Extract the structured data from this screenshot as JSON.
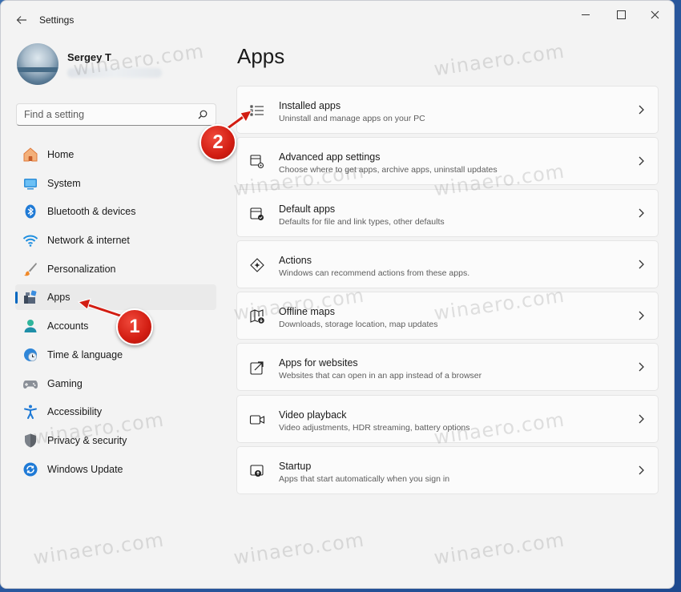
{
  "window": {
    "title": "Settings"
  },
  "profile": {
    "name": "Sergey T"
  },
  "search": {
    "placeholder": "Find a setting"
  },
  "nav": {
    "items": [
      {
        "label": "Home",
        "icon": "home-icon",
        "active": false
      },
      {
        "label": "System",
        "icon": "system-icon",
        "active": false
      },
      {
        "label": "Bluetooth & devices",
        "icon": "bluetooth-icon",
        "active": false
      },
      {
        "label": "Network & internet",
        "icon": "wifi-icon",
        "active": false
      },
      {
        "label": "Personalization",
        "icon": "brush-icon",
        "active": false
      },
      {
        "label": "Apps",
        "icon": "apps-icon",
        "active": true
      },
      {
        "label": "Accounts",
        "icon": "account-icon",
        "active": false
      },
      {
        "label": "Time & language",
        "icon": "clock-globe-icon",
        "active": false
      },
      {
        "label": "Gaming",
        "icon": "gamepad-icon",
        "active": false
      },
      {
        "label": "Accessibility",
        "icon": "accessibility-icon",
        "active": false
      },
      {
        "label": "Privacy & security",
        "icon": "shield-icon",
        "active": false
      },
      {
        "label": "Windows Update",
        "icon": "update-icon",
        "active": false
      }
    ]
  },
  "main": {
    "title": "Apps",
    "cards": [
      {
        "title": "Installed apps",
        "desc": "Uninstall and manage apps on your PC",
        "icon": "list-icon"
      },
      {
        "title": "Advanced app settings",
        "desc": "Choose where to get apps, archive apps, uninstall updates",
        "icon": "app-settings-icon"
      },
      {
        "title": "Default apps",
        "desc": "Defaults for file and link types, other defaults",
        "icon": "default-apps-icon"
      },
      {
        "title": "Actions",
        "desc": "Windows can recommend actions from these apps.",
        "icon": "actions-icon"
      },
      {
        "title": "Offline maps",
        "desc": "Downloads, storage location, map updates",
        "icon": "map-download-icon"
      },
      {
        "title": "Apps for websites",
        "desc": "Websites that can open in an app instead of a browser",
        "icon": "open-external-icon"
      },
      {
        "title": "Video playback",
        "desc": "Video adjustments, HDR streaming, battery options",
        "icon": "video-icon"
      },
      {
        "title": "Startup",
        "desc": "Apps that start automatically when you sign in",
        "icon": "startup-icon"
      }
    ]
  },
  "annotations": {
    "callout1": "1",
    "callout2": "2"
  },
  "watermark": "winaero.com",
  "colors": {
    "accent": "#0067c0",
    "callout": "#d21d12"
  }
}
